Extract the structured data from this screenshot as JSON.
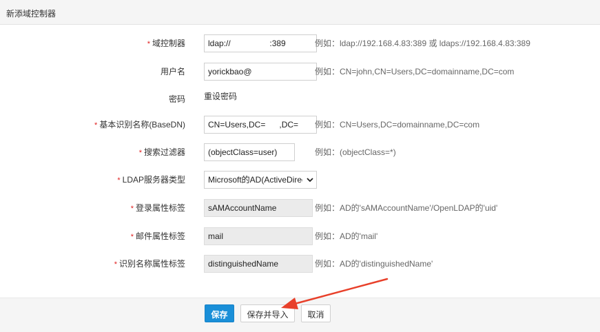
{
  "header": {
    "title": "新添域控制器"
  },
  "form": {
    "controller": {
      "label": "域控制器",
      "value": "ldap://                 :389",
      "hint": "例如：ldap://192.168.4.83:389 或 ldaps://192.168.4.83:389"
    },
    "username": {
      "label": "用户名",
      "value": "yorickbao@",
      "hint": "例如：CN=john,CN=Users,DC=domainname,DC=com"
    },
    "password": {
      "label": "密码",
      "link": "重设密码"
    },
    "basedn": {
      "label": "基本识别名称(BaseDN)",
      "value": "CN=Users,DC=      ,DC=",
      "hint": "例如：CN=Users,DC=domainname,DC=com"
    },
    "filter": {
      "label": "搜索过滤器",
      "value": "(objectClass=user)",
      "hint": "例如：(objectClass=*)"
    },
    "server_type": {
      "label": "LDAP服务器类型",
      "selected": "Microsoft的AD(ActiveDirectory)"
    },
    "login_attr": {
      "label": "登录属性标签",
      "value": "sAMAccountName",
      "hint": "例如：AD的'sAMAccountName'/OpenLDAP的'uid'"
    },
    "mail_attr": {
      "label": "邮件属性标签",
      "value": "mail",
      "hint": "例如：AD的'mail'"
    },
    "dn_attr": {
      "label": "识别名称属性标签",
      "value": "distinguishedName",
      "hint": "例如：AD的'distinguishedName'"
    },
    "required_mark": "*"
  },
  "footer": {
    "save_label": "保存",
    "save_import_label": "保存并导入",
    "cancel_label": "取消"
  },
  "annotation": {
    "arrow_color": "#e8402a"
  },
  "colors": {
    "primary": "#1a8fd8",
    "required": "#e02020"
  }
}
